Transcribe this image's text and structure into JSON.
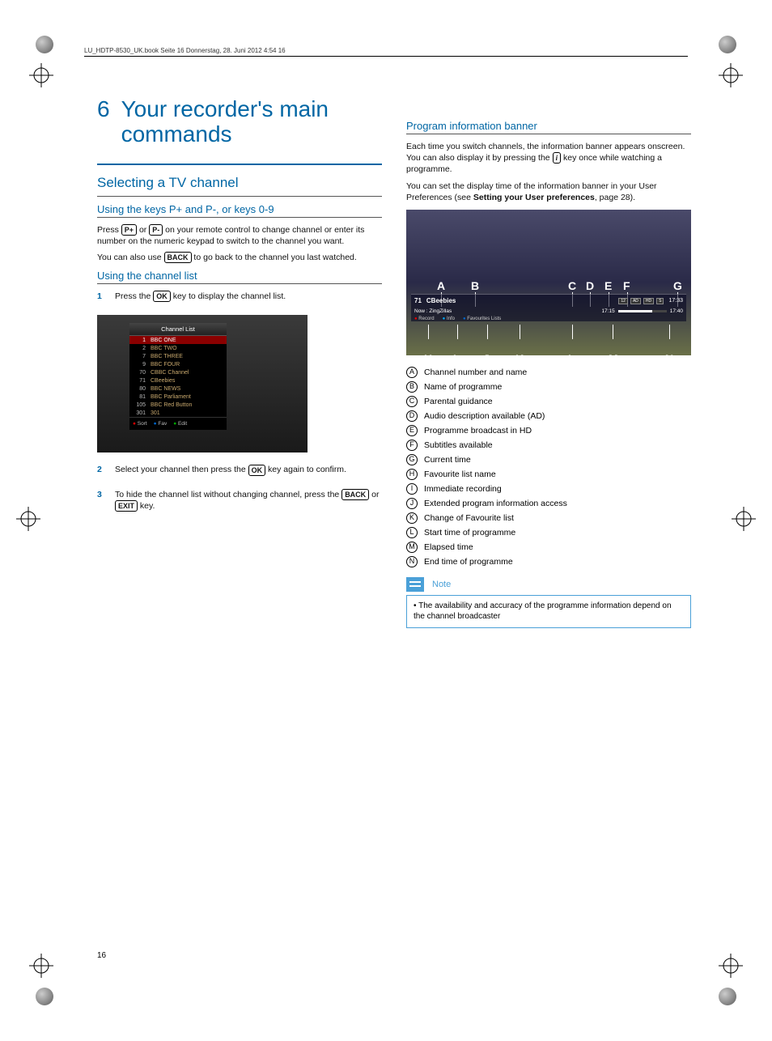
{
  "header_line": "LU_HDTP-8530_UK.book  Seite 16  Donnerstag, 28. Juni 2012  4:54 16",
  "chapter": {
    "num": "6",
    "title": "Your recorder's main commands"
  },
  "left": {
    "section": "Selecting a TV channel",
    "sub1": "Using the keys P+ and P-, or keys 0-9",
    "p1a": "Press ",
    "key_pplus": "P+",
    "p1b": " or ",
    "key_pminus": "P-",
    "p1c": " on your remote control to change channel or enter its number on the numeric keypad to switch to the channel you want.",
    "p2a": "You can also use ",
    "key_back": "BACK",
    "p2b": " to go back to the channel you last watched.",
    "sub2": "Using the channel list",
    "step1a": "Press the ",
    "key_ok": "OK",
    "step1b": " key to display the channel list.",
    "chlist": {
      "title": "Channel List",
      "rows": [
        {
          "n": "1",
          "name": "BBC ONE",
          "sel": true
        },
        {
          "n": "2",
          "name": "BBC TWO"
        },
        {
          "n": "7",
          "name": "BBC THREE"
        },
        {
          "n": "9",
          "name": "BBC FOUR"
        },
        {
          "n": "70",
          "name": "CBBC Channel"
        },
        {
          "n": "71",
          "name": "CBeebies"
        },
        {
          "n": "80",
          "name": "BBC NEWS"
        },
        {
          "n": "81",
          "name": "BBC Parliament"
        },
        {
          "n": "105",
          "name": "BBC Red Button"
        },
        {
          "n": "301",
          "name": "301"
        }
      ],
      "footer": {
        "sort": "Sort",
        "fav": "Fav",
        "edit": "Edit"
      }
    },
    "step2a": "Select your channel then press the ",
    "step2b": " key again to confirm.",
    "step3a": "To hide the channel list without changing channel, press the ",
    "key_exit": "EXIT",
    "step3b": " or ",
    "step3c": " key."
  },
  "right": {
    "sub": "Program information banner",
    "p1a": "Each time you switch channels, the information banner appears onscreen. You can also display it by pressing the ",
    "key_info": "i",
    "p1b": " key once while watching a programme.",
    "p2a": "You can set the display time of the information banner in your User Preferences (see ",
    "p2bold": "Setting your User preferences",
    "p2b": ", page 28).",
    "banner": {
      "top": [
        "A",
        "B",
        "C",
        "D",
        "E",
        "F",
        "G"
      ],
      "bot": [
        "H",
        "I",
        "J",
        "K",
        "L",
        "M",
        "N"
      ],
      "chnum": "71",
      "chname": "CBeebies",
      "icons": [
        "12",
        "AD",
        "HD",
        "S"
      ],
      "time": "17:33",
      "prog": "Now : ZingZillas",
      "t_start": "17:15",
      "t_end": "17:40",
      "rec": "Record",
      "info": "Info",
      "fav": "Favourites Lists"
    },
    "legend": [
      {
        "l": "A",
        "t": "Channel number and name"
      },
      {
        "l": "B",
        "t": "Name of programme"
      },
      {
        "l": "C",
        "t": "Parental guidance"
      },
      {
        "l": "D",
        "t": "Audio description available (AD)"
      },
      {
        "l": "E",
        "t": "Programme broadcast in HD"
      },
      {
        "l": "F",
        "t": "Subtitles available"
      },
      {
        "l": "G",
        "t": "Current time"
      },
      {
        "l": "H",
        "t": "Favourite list name"
      },
      {
        "l": "I",
        "t": "Immediate recording"
      },
      {
        "l": "J",
        "t": "Extended program information access"
      },
      {
        "l": "K",
        "t": "Change of Favourite list"
      },
      {
        "l": "L",
        "t": "Start time of programme"
      },
      {
        "l": "M",
        "t": "Elapsed time"
      },
      {
        "l": "N",
        "t": "End time of programme"
      }
    ],
    "note_label": "Note",
    "note_text": "The availability and accuracy of the programme information depend on the channel broadcaster"
  },
  "page_number": "16"
}
